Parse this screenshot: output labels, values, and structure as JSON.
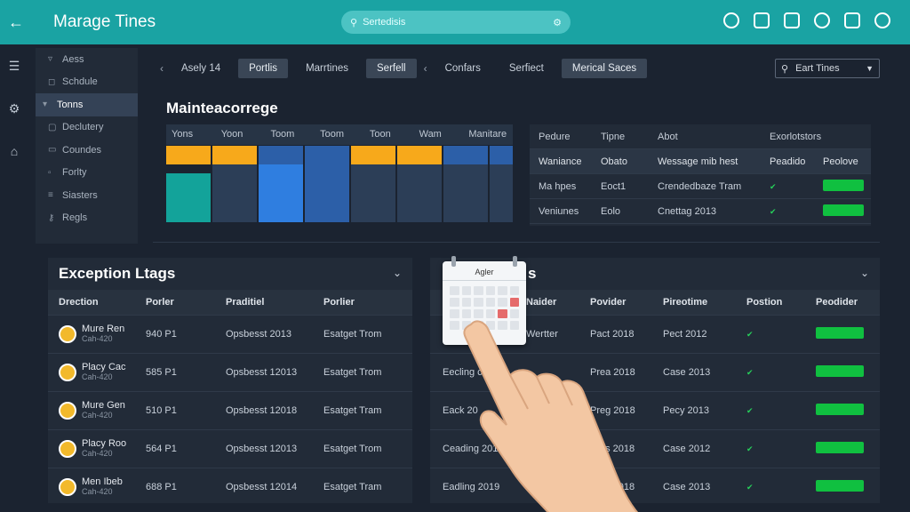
{
  "topbar": {
    "title": "Marage Tines",
    "search_placeholder": "Sertedisis"
  },
  "sidebar": {
    "items": [
      {
        "label": "Aess"
      },
      {
        "label": "Schdule"
      },
      {
        "label": "Tonns",
        "active": true
      },
      {
        "label": "Declutery"
      },
      {
        "label": "Coundes"
      },
      {
        "label": "Forlty"
      },
      {
        "label": "Siasters"
      },
      {
        "label": "Regls"
      }
    ]
  },
  "breadcrumbs": [
    "Asely 14",
    "Portlis",
    "Marrtines",
    "Serfell",
    "Confars",
    "Serfiect",
    "Merical Saces"
  ],
  "filter": {
    "label": "Eart Tines"
  },
  "maintenance": {
    "title": "Mainteacorrege",
    "columns": [
      "Yons",
      "Yoon",
      "Toom",
      "Toom",
      "Toon",
      "Wam",
      "Manitare"
    ]
  },
  "right_table": {
    "headers": [
      "Pedure",
      "Tipne",
      "Abot",
      "Exorlotstors"
    ],
    "subheader": [
      "Waniance",
      "Obato",
      "Wessage mib hest",
      "Peadido",
      "Peolove"
    ],
    "rows": [
      [
        "Ma hpes",
        "Eoct1",
        "Crendedbaze Tram"
      ],
      [
        "Veniunes",
        "Eolo",
        "Cnettag 2013"
      ]
    ]
  },
  "exception_logs": {
    "title": "Exception Ltags",
    "headers": [
      "Drection",
      "Porler",
      "Praditiel",
      "Porlier"
    ],
    "rows": [
      {
        "name": "Mure Ren",
        "sub": "Cah-420",
        "porler": "940 P1",
        "praditiel": "Opsbesst 2013",
        "porlier": "Esatget Trom"
      },
      {
        "name": "Placy Cac",
        "sub": "Cah-420",
        "porler": "585 P1",
        "praditiel": "Opsbesst 12013",
        "porlier": "Esatget Trom"
      },
      {
        "name": "Mure Gen",
        "sub": "Cah-420",
        "porler": "510 P1",
        "praditiel": "Opsbesst 12018",
        "porlier": "Esatget Tram"
      },
      {
        "name": "Placy Roo",
        "sub": "Cah-420",
        "porler": "564 P1",
        "praditiel": "Opsbesst 12013",
        "porlier": "Esatget Trom"
      },
      {
        "name": "Men Ibeb",
        "sub": "Cah-420",
        "porler": "688 P1",
        "praditiel": "Opsbesst 12014",
        "porlier": "Esatget Tram"
      }
    ]
  },
  "second_panel": {
    "title": "s",
    "headers": [
      "",
      "Naider",
      "Povider",
      "Pireotime",
      "Postion",
      "Peodider"
    ],
    "rows": [
      [
        "",
        "Wertter",
        "Pact 2018",
        "Pect 2012"
      ],
      [
        "Eecling c",
        "",
        "Prea 2018",
        "Case 2013"
      ],
      [
        "Eack 20",
        "",
        "Preg 2018",
        "Pecy 2013"
      ],
      [
        "Ceading 2015",
        "",
        "Pres 2018",
        "Case 2012"
      ],
      [
        "Eadling 2019",
        "",
        "Pres 2018",
        "Case 2013"
      ]
    ]
  },
  "calendar": {
    "month": "Agler"
  },
  "colors": {
    "accent": "#1aa3a3",
    "bar_orange": "#f7a91b",
    "bar_blue": "#2f7ee0",
    "bar_teal": "#13a39a",
    "status_green": "#10c040"
  }
}
